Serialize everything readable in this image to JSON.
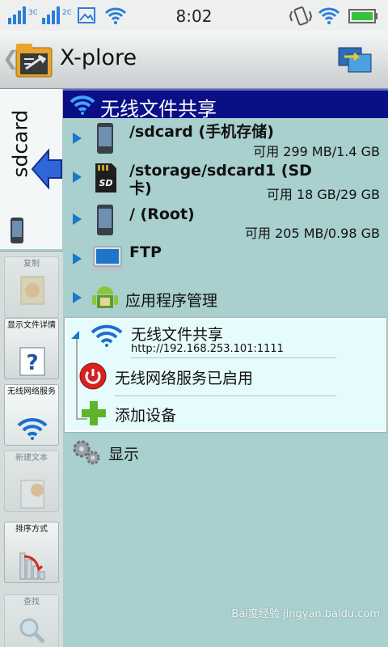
{
  "status_bar": {
    "time": "8:02",
    "signal_labels": [
      "3G",
      "2G"
    ],
    "icons": [
      "signal-icon",
      "signal-icon",
      "picture-icon",
      "wifi-icon",
      "vibrate-icon",
      "wifi-icon",
      "battery-icon"
    ]
  },
  "app": {
    "title": "X-plore",
    "title_icon": "xplore-logo-icon",
    "action_icon": "dual-pane-icon"
  },
  "left_panel": {
    "tab_label": "sdcard",
    "toolbar": [
      {
        "label": "复制",
        "icon": "new-document-icon",
        "enabled": false
      },
      {
        "label": "显示文件详情",
        "icon": "question-icon",
        "enabled": true
      },
      {
        "label": "无线网络服务",
        "icon": "wifi-icon",
        "enabled": true
      },
      {
        "label": "新建文本",
        "icon": "new-text-icon",
        "enabled": false
      },
      {
        "label": "排序方式",
        "icon": "sort-chart-icon",
        "enabled": true
      },
      {
        "label": "查找",
        "icon": "search-icon",
        "enabled": false
      }
    ]
  },
  "right_panel": {
    "header": "无线文件共享",
    "items": [
      {
        "name": "/sdcard (手机存储)",
        "meta": "可用 299 MB/1.4 GB",
        "icon": "phone-icon"
      },
      {
        "name": "/storage/sdcard1 (SD 卡)",
        "meta": "可用 18 GB/29 GB",
        "icon": "sd-card-icon"
      },
      {
        "name": "/ (Root)",
        "meta": "可用 205 MB/0.98 GB",
        "icon": "phone-icon"
      },
      {
        "name": "FTP",
        "meta": "",
        "icon": "computer-icon"
      },
      {
        "name": "应用程序管理",
        "meta": "",
        "icon": "android-icon"
      }
    ],
    "wifi_share": {
      "title": "无线文件共享",
      "url": "http://192.168.253.101:1111",
      "service_status": "无线网络服务已启用",
      "add_device": "添加设备"
    },
    "display": "显示"
  },
  "watermark": "Bai度经验 jingyan.baidu.com",
  "colors": {
    "header_bg": "#0a0f86",
    "list_bg": "#a9cfcf",
    "card_bg": "#e6fbfb",
    "arrow": "#1a78c8"
  }
}
